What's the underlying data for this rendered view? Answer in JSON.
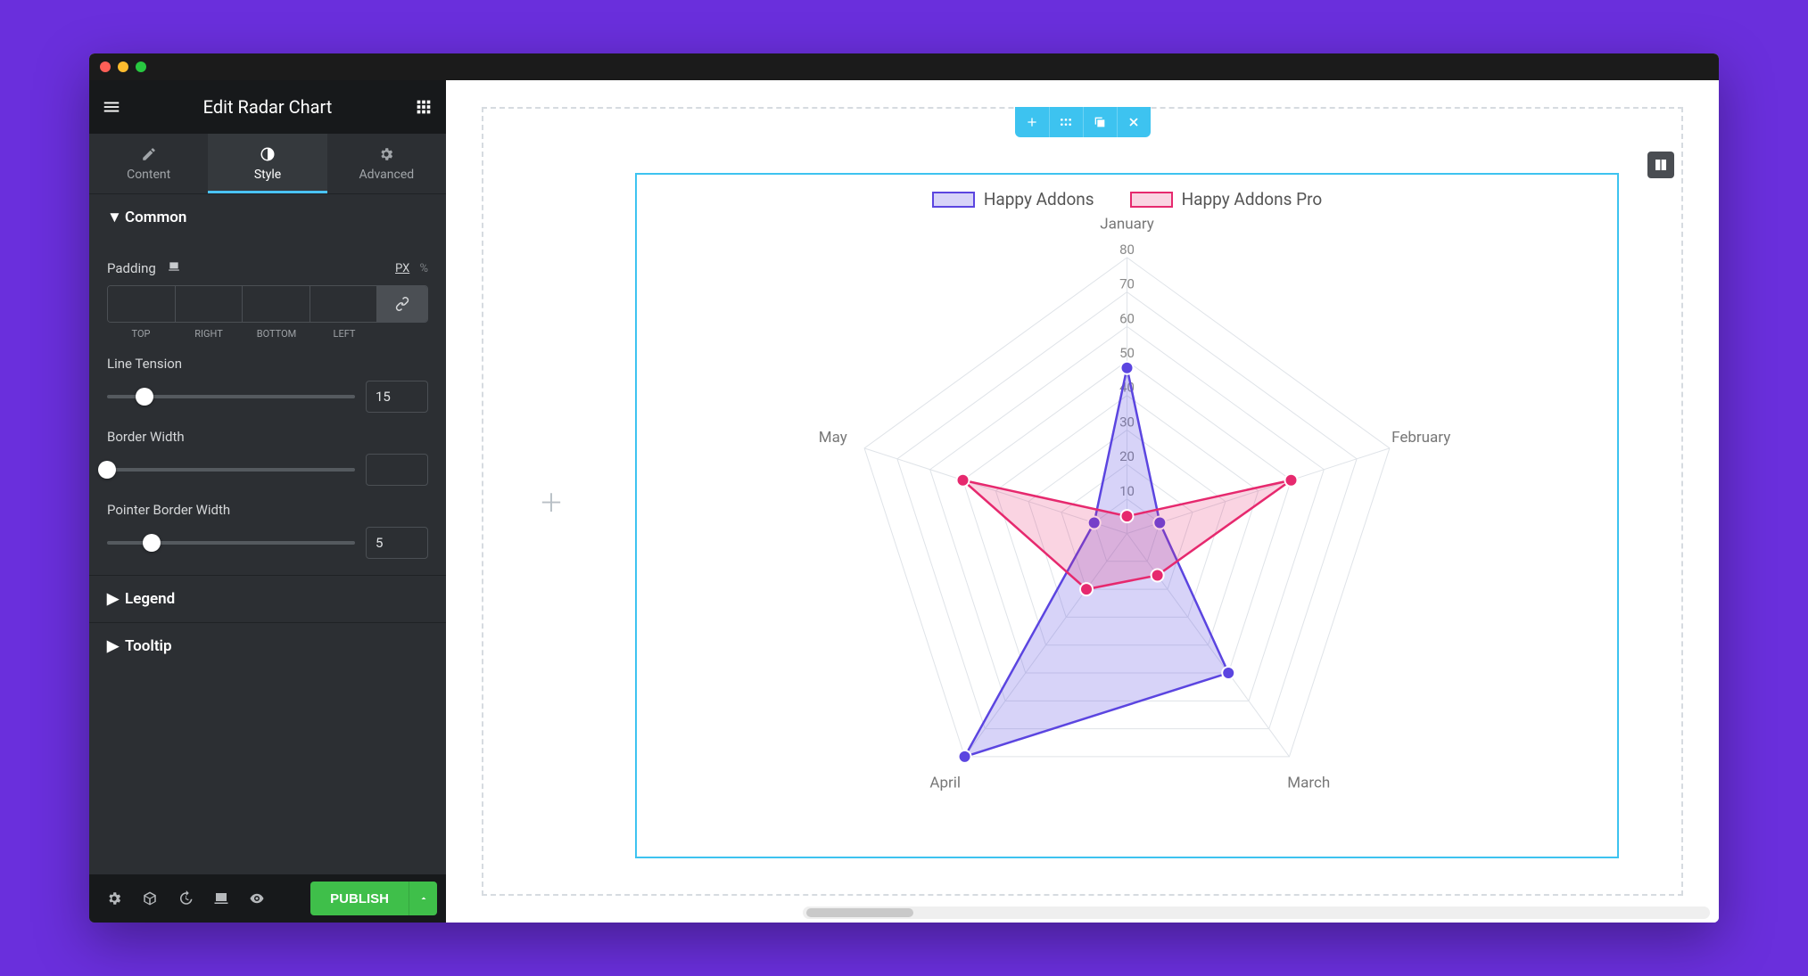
{
  "header": {
    "title": "Edit Radar Chart"
  },
  "tabs": {
    "content": "Content",
    "style": "Style",
    "advanced": "Advanced"
  },
  "sections": {
    "common": {
      "title": "Common",
      "padding_label": "Padding",
      "unit_px": "PX",
      "unit_pct": "%",
      "sides": {
        "top": "TOP",
        "right": "RIGHT",
        "bottom": "BOTTOM",
        "left": "LEFT"
      },
      "line_tension_label": "Line Tension",
      "line_tension_value": "15",
      "border_width_label": "Border Width",
      "border_width_value": "",
      "pointer_border_label": "Pointer Border Width",
      "pointer_border_value": "5"
    },
    "legend": {
      "title": "Legend"
    },
    "tooltip": {
      "title": "Tooltip"
    }
  },
  "footer": {
    "publish": "PUBLISH"
  },
  "canvas": {
    "legend": {
      "series_a": "Happy Addons",
      "series_b": "Happy Addons Pro"
    }
  },
  "chart_data": {
    "type": "radar",
    "categories": [
      "January",
      "February",
      "March",
      "April",
      "May"
    ],
    "ticks": [
      10,
      20,
      30,
      40,
      50,
      60,
      70,
      80
    ],
    "max": 80,
    "series": [
      {
        "name": "Happy Addons",
        "color": "#5b45e0",
        "fill": "rgba(97,78,226,0.25)",
        "values": [
          48,
          10,
          50,
          80,
          10
        ]
      },
      {
        "name": "Happy Addons Pro",
        "color": "#e6296e",
        "fill": "rgba(230,41,110,0.20)",
        "values": [
          5,
          50,
          15,
          20,
          50
        ]
      }
    ]
  }
}
